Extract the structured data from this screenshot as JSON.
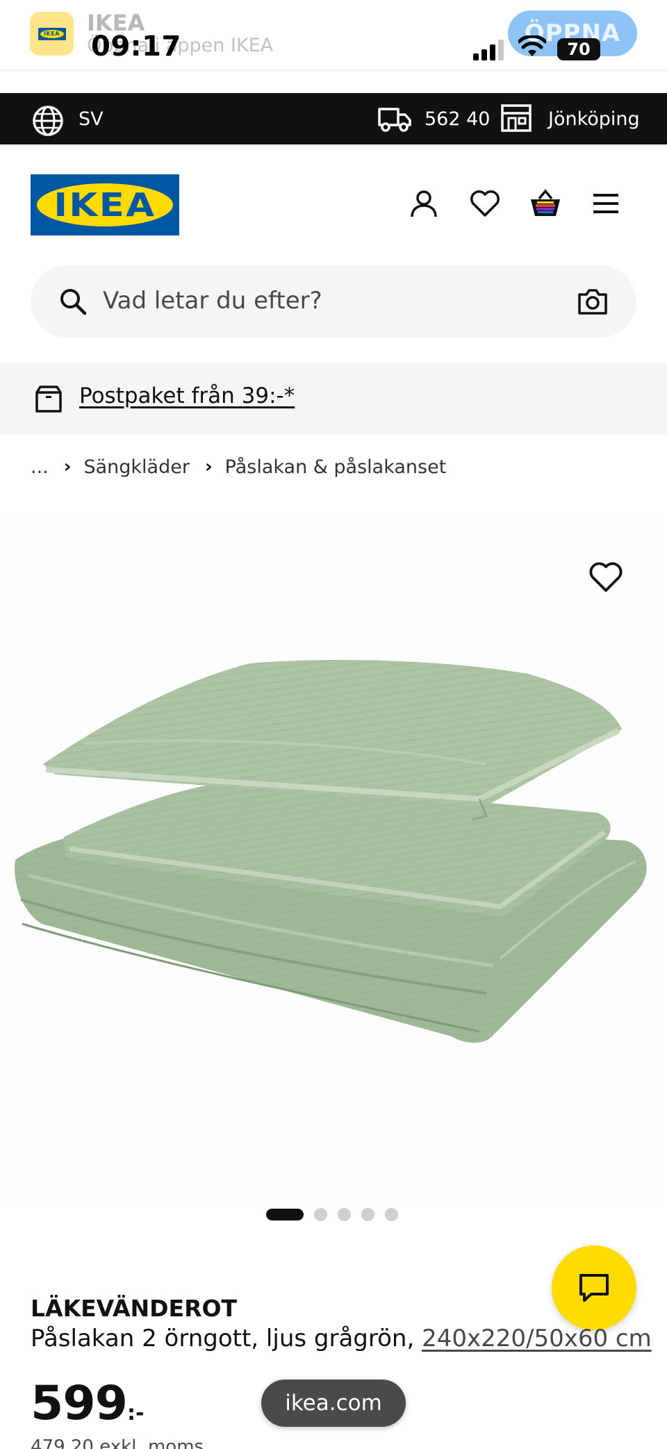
{
  "status_bar": {
    "time": "09:17",
    "battery": "70"
  },
  "app_banner": {
    "title": "IKEA",
    "subtitle": "Öppna i appen IKEA",
    "open_button": "ÖPPNA",
    "logo_text": "IKEA"
  },
  "top_bar": {
    "language": "SV",
    "postal_code": "562 40",
    "store": "Jönköping"
  },
  "header": {
    "logo_text": "IKEA"
  },
  "search": {
    "placeholder": "Vad letar du efter?"
  },
  "promo": {
    "text": "Postpaket från 39:-*"
  },
  "breadcrumb": {
    "ellipsis": "...",
    "items": [
      "Sängkläder",
      "Påslakan & påslakanset"
    ]
  },
  "gallery": {
    "image_count": 5,
    "active_index": 0
  },
  "product": {
    "name": "LÄKEVÄNDEROT",
    "description": "Påslakan 2 örngott, ljus grågrön,",
    "size": "240x220/50x60 cm",
    "price": "599",
    "currency": ":-",
    "price_ex_vat": "479,20 exkl. moms"
  },
  "browser": {
    "url": "ikea.com"
  },
  "colors": {
    "ikea_blue": "#0058a3",
    "ikea_yellow": "#ffdb00",
    "product_green": "#a3bc9a"
  }
}
